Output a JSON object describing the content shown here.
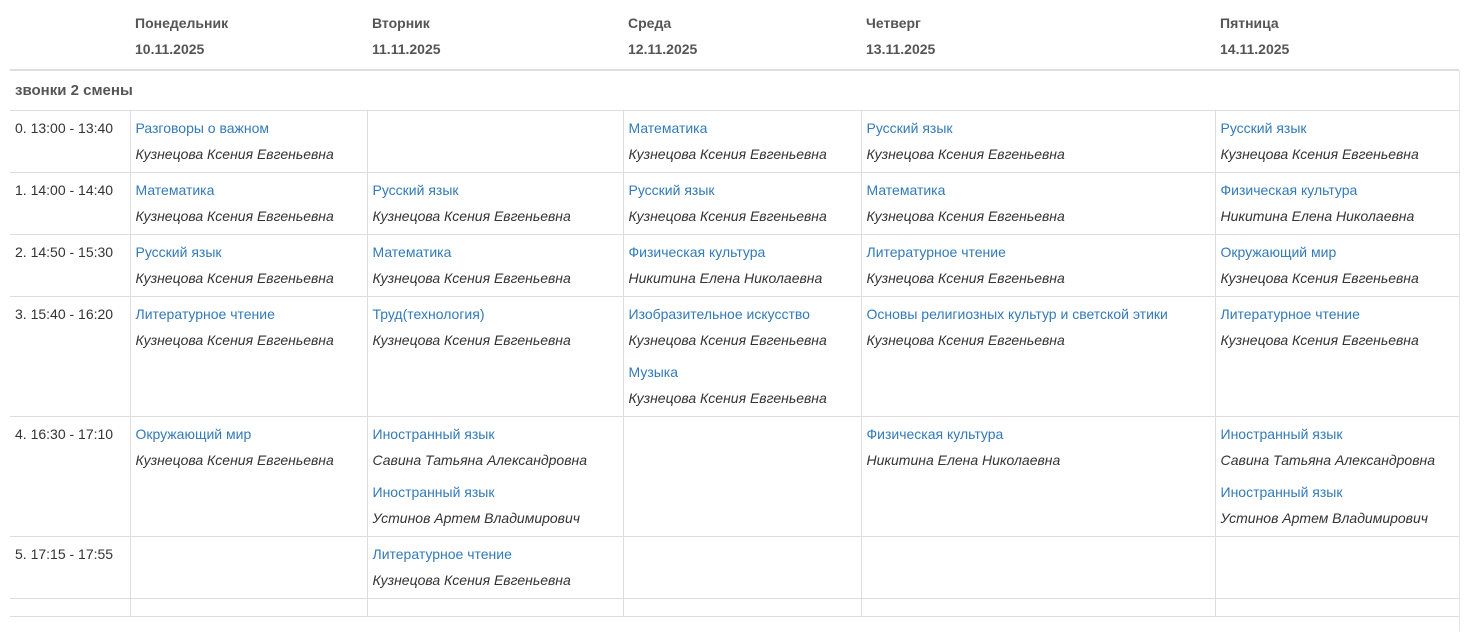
{
  "days": [
    {
      "name": "Понедельник",
      "date": "10.11.2025"
    },
    {
      "name": "Вторник",
      "date": "11.11.2025"
    },
    {
      "name": "Среда",
      "date": "12.11.2025"
    },
    {
      "name": "Четверг",
      "date": "13.11.2025"
    },
    {
      "name": "Пятница",
      "date": "14.11.2025"
    }
  ],
  "shift_label": "звонки 2 смены",
  "rows": [
    {
      "time": "0. 13:00 - 13:40",
      "cells": [
        [
          {
            "subject": "Разговоры о важном",
            "teacher": "Кузнецова Ксения Евгеньевна"
          }
        ],
        [],
        [
          {
            "subject": "Математика",
            "teacher": "Кузнецова Ксения Евгеньевна"
          }
        ],
        [
          {
            "subject": "Русский язык",
            "teacher": "Кузнецова Ксения Евгеньевна"
          }
        ],
        [
          {
            "subject": "Русский язык",
            "teacher": "Кузнецова Ксения Евгеньевна"
          }
        ]
      ]
    },
    {
      "time": "1. 14:00 - 14:40",
      "cells": [
        [
          {
            "subject": "Математика",
            "teacher": "Кузнецова Ксения Евгеньевна"
          }
        ],
        [
          {
            "subject": "Русский язык",
            "teacher": "Кузнецова Ксения Евгеньевна"
          }
        ],
        [
          {
            "subject": "Русский язык",
            "teacher": "Кузнецова Ксения Евгеньевна"
          }
        ],
        [
          {
            "subject": "Математика",
            "teacher": "Кузнецова Ксения Евгеньевна"
          }
        ],
        [
          {
            "subject": "Физическая культура",
            "teacher": "Никитина Елена Николаевна"
          }
        ]
      ]
    },
    {
      "time": "2. 14:50 - 15:30",
      "cells": [
        [
          {
            "subject": "Русский язык",
            "teacher": "Кузнецова Ксения Евгеньевна"
          }
        ],
        [
          {
            "subject": "Математика",
            "teacher": "Кузнецова Ксения Евгеньевна"
          }
        ],
        [
          {
            "subject": "Физическая культура",
            "teacher": "Никитина Елена Николаевна"
          }
        ],
        [
          {
            "subject": "Литературное чтение",
            "teacher": "Кузнецова Ксения Евгеньевна"
          }
        ],
        [
          {
            "subject": "Окружающий мир",
            "teacher": "Кузнецова Ксения Евгеньевна"
          }
        ]
      ]
    },
    {
      "time": "3. 15:40 - 16:20",
      "cells": [
        [
          {
            "subject": "Литературное чтение",
            "teacher": "Кузнецова Ксения Евгеньевна"
          }
        ],
        [
          {
            "subject": "Труд(технология)",
            "teacher": "Кузнецова Ксения Евгеньевна"
          }
        ],
        [
          {
            "subject": "Изобразительное искусство",
            "teacher": "Кузнецова Ксения Евгеньевна"
          },
          {
            "subject": "Музыка",
            "teacher": "Кузнецова Ксения Евгеньевна"
          }
        ],
        [
          {
            "subject": "Основы религиозных культур и светской этики",
            "teacher": "Кузнецова Ксения Евгеньевна"
          }
        ],
        [
          {
            "subject": "Литературное чтение",
            "teacher": "Кузнецова Ксения Евгеньевна"
          }
        ]
      ]
    },
    {
      "time": "4. 16:30 - 17:10",
      "cells": [
        [
          {
            "subject": "Окружающий мир",
            "teacher": "Кузнецова Ксения Евгеньевна"
          }
        ],
        [
          {
            "subject": "Иностранный язык",
            "teacher": "Савина Татьяна Александровна"
          },
          {
            "subject": "Иностранный язык",
            "teacher": "Устинов Артем Владимирович"
          }
        ],
        [],
        [
          {
            "subject": "Физическая культура",
            "teacher": "Никитина Елена Николаевна"
          }
        ],
        [
          {
            "subject": "Иностранный язык",
            "teacher": "Савина Татьяна Александровна"
          },
          {
            "subject": "Иностранный язык",
            "teacher": "Устинов Артем Владимирович"
          }
        ]
      ]
    },
    {
      "time": "5. 17:15 - 17:55",
      "cells": [
        [],
        [
          {
            "subject": "Литературное чтение",
            "teacher": "Кузнецова Ксения Евгеньевна"
          }
        ],
        [],
        [],
        []
      ]
    },
    {
      "time": "",
      "cells": [
        [],
        [],
        [],
        [],
        []
      ]
    }
  ],
  "colors": {
    "link": "#337ab7",
    "text": "#333333",
    "header_text": "#555555",
    "border": "#dddddd"
  }
}
